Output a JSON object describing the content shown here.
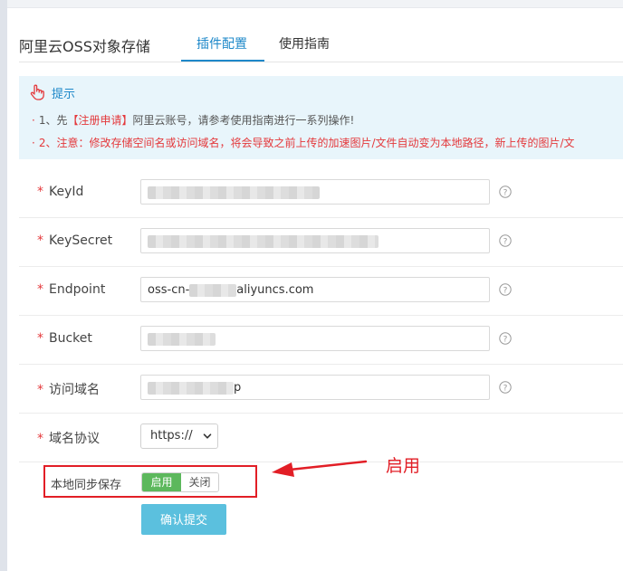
{
  "header": {
    "title": "阿里云OSS对象存储",
    "tabs": [
      {
        "label": "插件配置",
        "active": true
      },
      {
        "label": "使用指南",
        "active": false
      }
    ]
  },
  "notice": {
    "title": "提示",
    "line1_prefix": "1、先",
    "line1_link": "【注册申请】",
    "line1_suffix": "阿里云账号，请参考使用指南进行一系列操作!",
    "line2": "2、注意：修改存储空间名或访问域名，将会导致之前上传的加速图片/文件自动变为本地路径，新上传的图片/文"
  },
  "form": {
    "keyid_label": "KeyId",
    "keysecret_label": "KeySecret",
    "endpoint_label": "Endpoint",
    "endpoint_prefix": "oss-cn-",
    "endpoint_suffix": "aliyuncs.com",
    "bucket_label": "Bucket",
    "domain_label": "访问域名",
    "domain_suffix": "p",
    "protocol_label": "域名协议",
    "protocol_value": "https://",
    "sync_label": "本地同步保存",
    "sync_on": "启用",
    "sync_off": "关闭",
    "submit": "确认提交"
  },
  "annotation": {
    "text": "启用"
  },
  "colors": {
    "accent": "#1e88c9",
    "warning": "#e4393c",
    "toggle_on": "#5cb85c",
    "submit": "#5bc0de",
    "annotation": "#e21e26"
  }
}
